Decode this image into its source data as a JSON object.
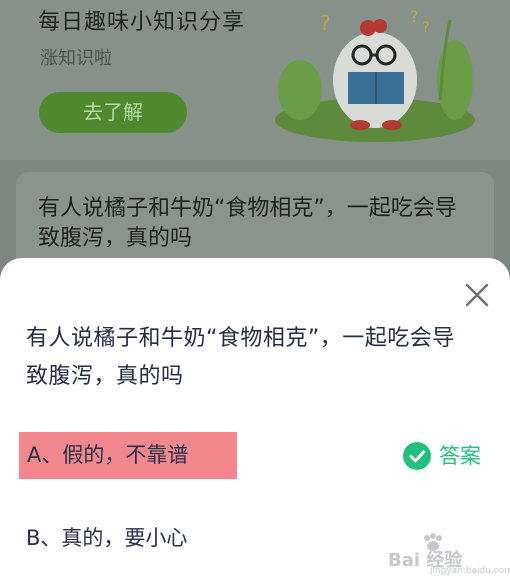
{
  "banner": {
    "title": "每日趣味小知识分享",
    "subtitle": "涨知识啦",
    "button_label": "去了解"
  },
  "background_card": {
    "question": "有人说橘子和牛奶“食物相克”，一起吃会导致腹泻，真的吗"
  },
  "sheet": {
    "question": "有人说橘子和牛奶“食物相克”，一起吃会导致腹泻，真的吗",
    "options": [
      {
        "label": "A、假的，不靠谱",
        "highlighted": true
      },
      {
        "label": "B、真的，要小心",
        "highlighted": false
      }
    ],
    "answer_label": "答案",
    "close_icon": "close-icon",
    "answer_icon": "check-circle-icon"
  },
  "watermark": {
    "text": "Bai 经验",
    "url": "jingyan.baidu.com"
  },
  "colors": {
    "overlay": "#7d8781",
    "question_text": "#232c49",
    "highlight": "#f2878d",
    "answer_green": "#22c07a"
  }
}
